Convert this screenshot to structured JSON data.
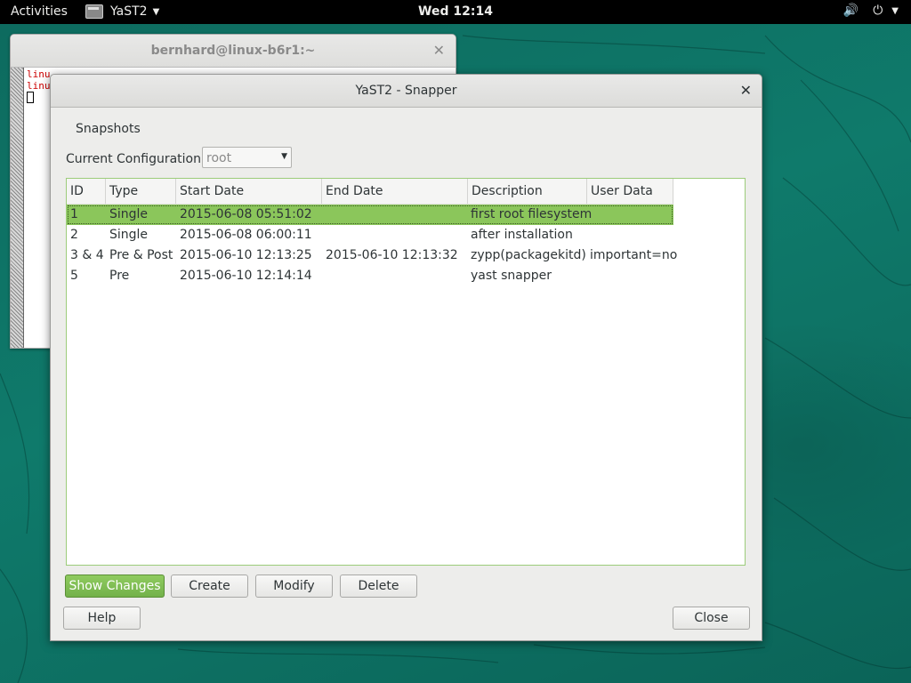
{
  "topbar": {
    "activities": "Activities",
    "app_name": "YaST2",
    "clock": "Wed 12:14",
    "icons": [
      "volume-icon",
      "power-icon",
      "chevron-down-icon"
    ]
  },
  "terminal": {
    "title": "bernhard@linux-b6r1:~",
    "lines": [
      "linu",
      "linu"
    ]
  },
  "dialog": {
    "title": "YaST2 - Snapper",
    "section": "Snapshots",
    "config_label": "Current Configuration",
    "config_value": "root",
    "columns": [
      "ID",
      "Type",
      "Start Date",
      "End Date",
      "Description",
      "User Data"
    ],
    "rows": [
      {
        "id": "1",
        "type": "Single",
        "start": "2015-06-08 05:51:02",
        "end": "",
        "desc": "first root filesystem",
        "user": ""
      },
      {
        "id": "2",
        "type": "Single",
        "start": "2015-06-08 06:00:11",
        "end": "",
        "desc": "after installation",
        "user": ""
      },
      {
        "id": "3 & 4",
        "type": "Pre & Post",
        "start": "2015-06-10 12:13:25",
        "end": "2015-06-10 12:13:32",
        "desc": "zypp(packagekitd)",
        "user": "important=no"
      },
      {
        "id": "5",
        "type": "Pre",
        "start": "2015-06-10 12:14:14",
        "end": "",
        "desc": "yast snapper",
        "user": ""
      }
    ],
    "buttons": {
      "show_changes": "Show Changes",
      "create": "Create",
      "modify": "Modify",
      "delete": "Delete",
      "help": "Help",
      "close": "Close"
    }
  },
  "colors": {
    "accent": "#8bc65b",
    "desktop": "#0f6e62"
  }
}
